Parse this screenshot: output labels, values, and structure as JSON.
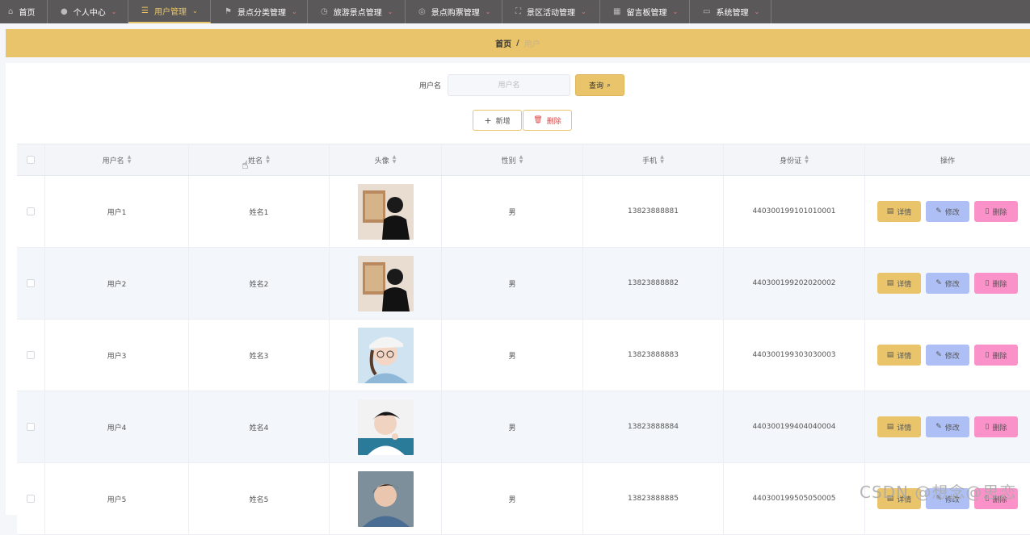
{
  "nav": {
    "items": [
      {
        "label": "首页",
        "icon": "home-icon",
        "active": false
      },
      {
        "label": "个人中心",
        "icon": "user-icon",
        "active": false
      },
      {
        "label": "用户管理",
        "icon": "list-icon",
        "active": true
      },
      {
        "label": "景点分类管理",
        "icon": "flag-icon",
        "active": false
      },
      {
        "label": "旅游景点管理",
        "icon": "clock-icon",
        "active": false
      },
      {
        "label": "景点购票管理",
        "icon": "compass-icon",
        "active": false
      },
      {
        "label": "景区活动管理",
        "icon": "fullscreen-icon",
        "active": false
      },
      {
        "label": "留言板管理",
        "icon": "bank-icon",
        "active": false
      },
      {
        "label": "系统管理",
        "icon": "monitor-icon",
        "active": false
      }
    ]
  },
  "breadcrumb": {
    "home": "首页",
    "separator": "/",
    "current": "用户"
  },
  "search": {
    "label": "用户名",
    "placeholder": "用户名",
    "value": "",
    "query_label": "查询"
  },
  "toolbar": {
    "add_label": "新增",
    "delete_label": "删除"
  },
  "table": {
    "headers": [
      "用户名",
      "姓名",
      "头像",
      "性别",
      "手机",
      "身份证",
      "操作"
    ],
    "rows": [
      {
        "username": "用户1",
        "name": "姓名1",
        "avatar": "photo-back-view",
        "gender": "男",
        "phone": "13823888881",
        "idcard": "440300199101010001"
      },
      {
        "username": "用户2",
        "name": "姓名2",
        "avatar": "photo-back-view",
        "gender": "男",
        "phone": "13823888882",
        "idcard": "440300199202020002"
      },
      {
        "username": "用户3",
        "name": "姓名3",
        "avatar": "photo-girl-cap",
        "gender": "男",
        "phone": "13823888883",
        "idcard": "440300199303030003"
      },
      {
        "username": "用户4",
        "name": "姓名4",
        "avatar": "photo-boy-white",
        "gender": "男",
        "phone": "13823888884",
        "idcard": "440300199404040004"
      },
      {
        "username": "用户5",
        "name": "姓名5",
        "avatar": "photo-boy-denim",
        "gender": "男",
        "phone": "13823888885",
        "idcard": "440300199505050005"
      }
    ],
    "actions": {
      "detail": "详情",
      "edit": "修改",
      "delete": "删除"
    }
  },
  "watermark": "CSDN @想念@思恋",
  "colors": {
    "accent": "#e9c46a",
    "nav_bg": "#5a5858",
    "edit": "#adbff5",
    "delete": "#fb91c9"
  }
}
